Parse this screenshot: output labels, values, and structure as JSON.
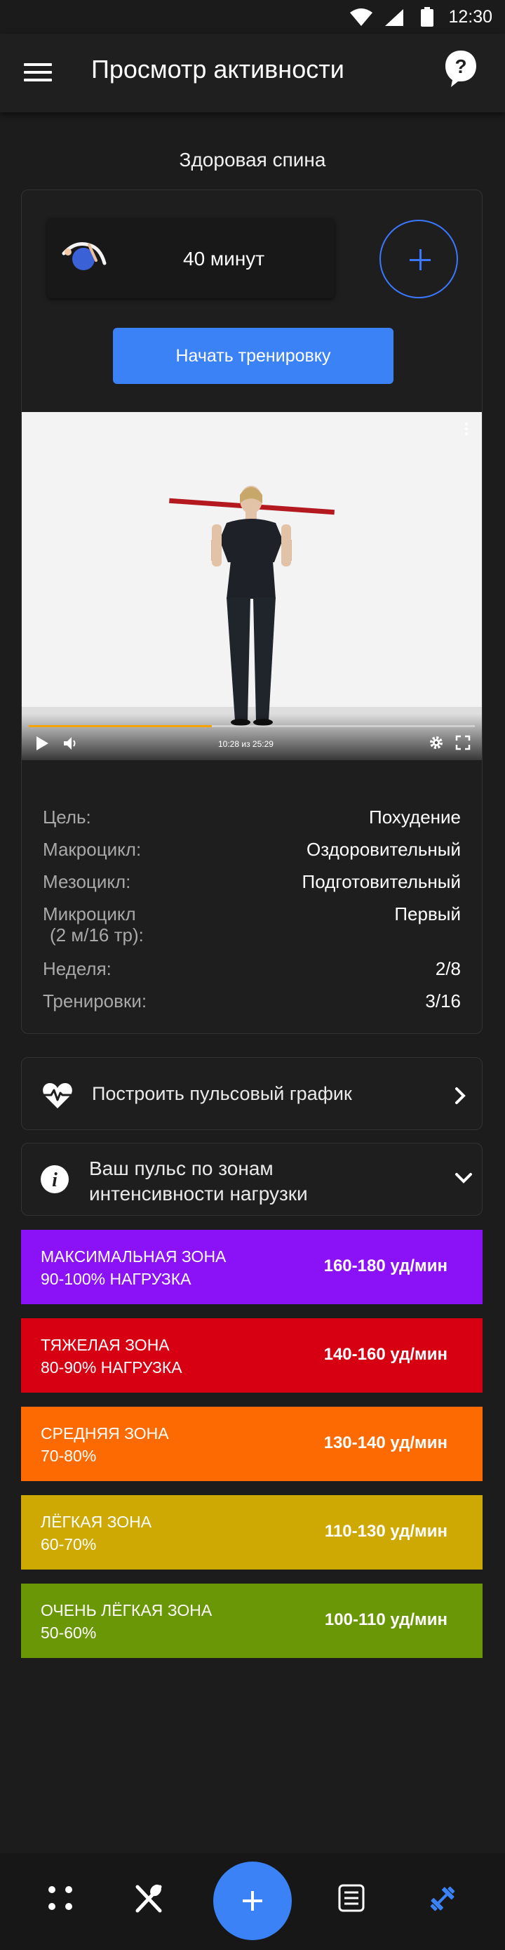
{
  "status_bar": {
    "time": "12:30"
  },
  "app_bar": {
    "title": "Просмотр активности",
    "menu_icon": "hamburger-icon",
    "help_icon": "help-bubble-icon"
  },
  "activity": {
    "name": "Здоровая спина",
    "duration": "40 минут",
    "start_button": "Начать тренировку"
  },
  "video": {
    "time": "10:28 из 25:29",
    "progress": 0.41
  },
  "info": [
    {
      "key": "Цель:",
      "value": "Похудение"
    },
    {
      "key": "Макроцикл:",
      "value": "Оздоровительный"
    },
    {
      "key": "Мезоцикл:",
      "value": "Подготовительный"
    },
    {
      "key": "Микроцикл",
      "key2": "(2 м/16 тр):",
      "value": "Первый"
    },
    {
      "key": "Неделя:",
      "value": "2/8"
    },
    {
      "key": "Тренировки:",
      "value": "3/16"
    }
  ],
  "pulse_button": {
    "label": "Построить пульсовый график"
  },
  "zones_header": {
    "line1": "Ваш пульс по зонам",
    "line2": "интенсивности нагрузки"
  },
  "zones": [
    {
      "name": "МАКСИМАЛЬНАЯ ЗОНА",
      "load": "90-100% НАГРУЗКА",
      "rate": "160-180 уд/мин",
      "color": "#8b12f7"
    },
    {
      "name": "ТЯЖЕЛАЯ ЗОНА",
      "load": "80-90% НАГРУЗКА",
      "rate": "140-160 уд/мин",
      "color": "#d70012"
    },
    {
      "name": "СРЕДНЯЯ ЗОНА",
      "load": "70-80%",
      "rate": "130-140 уд/мин",
      "color": "#fd6a02"
    },
    {
      "name": "ЛЁГКАЯ ЗОНА",
      "load": "60-70%",
      "rate": "110-130 уд/мин",
      "color": "#cfa903"
    },
    {
      "name": "ОЧЕНЬ ЛЁГКАЯ ЗОНА",
      "load": "50-60%",
      "rate": "100-110 уд/мин",
      "color": "#6a9705"
    }
  ],
  "colors": {
    "accent": "#3b82f6",
    "background": "#1c1c1c"
  }
}
